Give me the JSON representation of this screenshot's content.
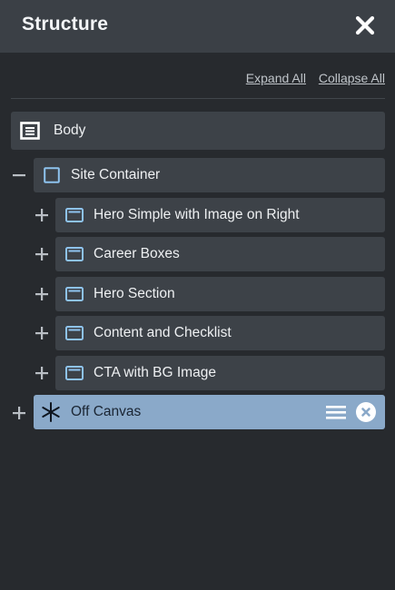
{
  "panel": {
    "title": "Structure",
    "expand_all": "Expand All",
    "collapse_all": "Collapse All"
  },
  "tree": {
    "body": {
      "label": "Body",
      "icon": "document-icon"
    },
    "site_container": {
      "label": "Site Container",
      "icon": "square-icon",
      "toggle": "collapse"
    },
    "children": [
      {
        "label": "Hero Simple with Image on Right",
        "icon": "section-icon",
        "toggle": "expand"
      },
      {
        "label": "Career Boxes",
        "icon": "section-icon",
        "toggle": "expand"
      },
      {
        "label": "Hero Section",
        "icon": "section-icon",
        "toggle": "expand"
      },
      {
        "label": "Content and Checklist",
        "icon": "section-icon",
        "toggle": "expand"
      },
      {
        "label": "CTA with BG Image",
        "icon": "section-icon",
        "toggle": "expand"
      }
    ],
    "off_canvas": {
      "label": "Off Canvas",
      "icon": "asterisk-icon",
      "toggle": "expand",
      "selected": true
    }
  },
  "colors": {
    "background": "#272a2e",
    "header": "#3b4046",
    "row": "#3d4248",
    "selected_row": "#8aa9c9",
    "icon_blue": "#8ec3ee"
  }
}
